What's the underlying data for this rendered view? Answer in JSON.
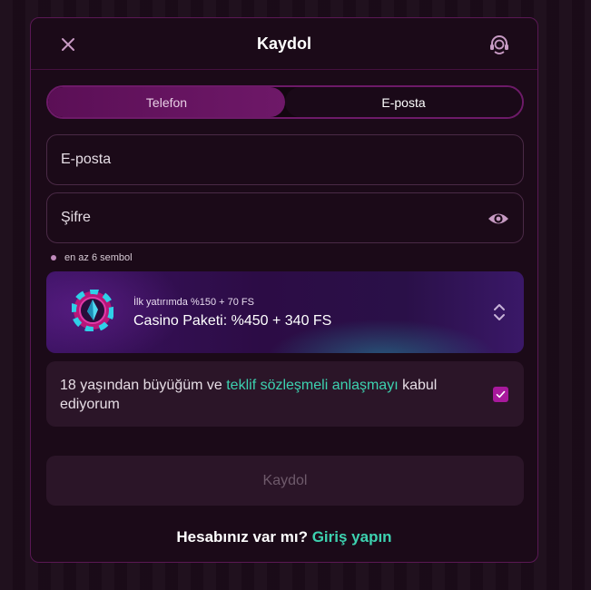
{
  "header": {
    "title": "Kaydol"
  },
  "tabs": [
    {
      "label": "Telefon",
      "active": true
    },
    {
      "label": "E-posta",
      "active": false
    }
  ],
  "email_field": {
    "placeholder": "E-posta"
  },
  "password_field": {
    "placeholder": "Şifre"
  },
  "password_hint": "en az 6 sembol",
  "bonus": {
    "subtitle": "İlk yatırımda %150 + 70 FS",
    "title": "Casino Paketi: %450 + 340 FS"
  },
  "agreement": {
    "text_before": "18 yaşından büyüğüm ve ",
    "link": "teklif sözleşmeli anlaşmayı",
    "text_after": " kabul ediyorum",
    "checked": true
  },
  "submit_label": "Kaydol",
  "footer": {
    "question": "Hesabınız var mı?",
    "login_link": "Giriş yapın"
  },
  "colors": {
    "accent": "#a8199c",
    "link": "#3dd2b0",
    "background": "#1b0a18"
  }
}
